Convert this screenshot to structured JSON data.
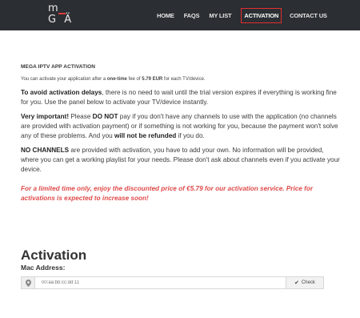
{
  "nav": {
    "logo_top": "m",
    "logo_bottom": "G Ä",
    "items": [
      "HOME",
      "FAQS",
      "MY LIST",
      "ACTIVATION",
      "CONTACT US"
    ]
  },
  "content": {
    "heading": "MEGA IPTV APP ACTIVATION",
    "fee_pre": "You can activate your application after a ",
    "fee_bold": "one-time",
    "fee_mid": " fee of ",
    "fee_amount": "5.79 EUR",
    "fee_post": " for each TV/device.",
    "p1_bold": "To avoid activation delays",
    "p1_rest": ", there is no need to wait until the trial version expires if everything is working fine for you. Use the panel below to activate your TV/device instantly.",
    "p2_bold1": "Very important!",
    "p2_mid1": " Please ",
    "p2_bold2": "DO NOT",
    "p2_mid2": " pay if you don't have any channels to use with the application (no channels are provided with activation payment) or if something is not working for you, because the payment won't solve any of these problems. And you ",
    "p2_bold3": "will not be refunded",
    "p2_end": " if you do.",
    "p3_bold": "NO CHANNELS",
    "p3_rest": " are provided with activation, you have to add your own. No information will be provided, where you can get a working playlist for your needs. Please don't ask about channels even if you activate your device.",
    "promo": "For a limited time only, enjoy the discounted price of €5.79 for our activation service. Price for activations is expected to increase soon!"
  },
  "activation": {
    "title": "Activation",
    "mac_label": "Mac Address:",
    "mac_placeholder": "00:aa:bb:cc:dd:11",
    "check_label": "Check",
    "pin_icon": "map-marker-icon",
    "check_icon": "checkmark-icon"
  },
  "colors": {
    "topbar": "#2b2e33",
    "accent_red": "#e23030",
    "promo_red": "#e04a4a"
  }
}
